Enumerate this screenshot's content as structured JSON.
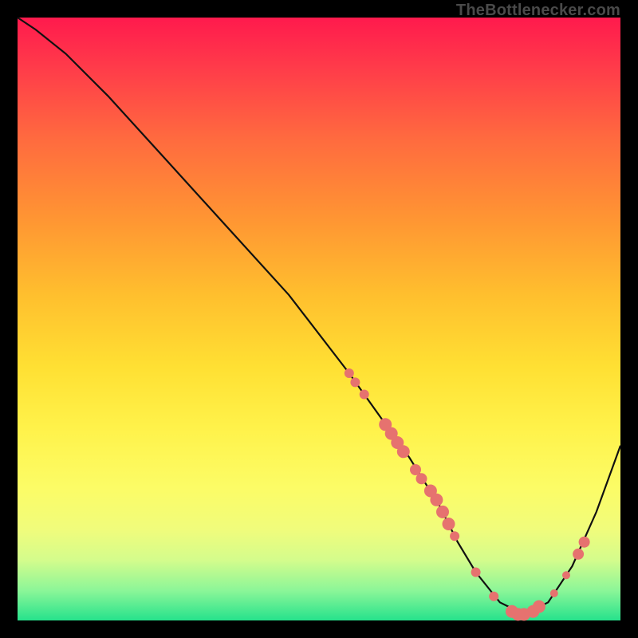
{
  "watermark": "TheBottlenecker.com",
  "chart_data": {
    "type": "line",
    "title": "",
    "xlabel": "",
    "ylabel": "",
    "xlim": [
      0,
      100
    ],
    "ylim": [
      0,
      100
    ],
    "grid": false,
    "legend": false,
    "x": [
      0,
      3,
      8,
      15,
      25,
      35,
      45,
      55,
      60,
      65,
      70,
      73,
      76,
      80,
      84,
      88,
      92,
      96,
      100
    ],
    "y": [
      100,
      98,
      94,
      87,
      76,
      65,
      54,
      41,
      34,
      27,
      19,
      13,
      8,
      3,
      1,
      3,
      9,
      18,
      29
    ],
    "series_note": "Single V-shaped bottleneck curve; minimum near x≈83",
    "markers": [
      {
        "x": 55.0,
        "y": 41.0,
        "r": 6
      },
      {
        "x": 56.0,
        "y": 39.5,
        "r": 6
      },
      {
        "x": 57.5,
        "y": 37.5,
        "r": 6
      },
      {
        "x": 61.0,
        "y": 32.5,
        "r": 8
      },
      {
        "x": 62.0,
        "y": 31.0,
        "r": 8
      },
      {
        "x": 63.0,
        "y": 29.5,
        "r": 8
      },
      {
        "x": 64.0,
        "y": 28.0,
        "r": 8
      },
      {
        "x": 66.0,
        "y": 25.0,
        "r": 7
      },
      {
        "x": 67.0,
        "y": 23.5,
        "r": 7
      },
      {
        "x": 68.5,
        "y": 21.5,
        "r": 8
      },
      {
        "x": 69.5,
        "y": 20.0,
        "r": 8
      },
      {
        "x": 70.5,
        "y": 18.0,
        "r": 8
      },
      {
        "x": 71.5,
        "y": 16.0,
        "r": 8
      },
      {
        "x": 72.5,
        "y": 14.0,
        "r": 6
      },
      {
        "x": 76.0,
        "y": 8.0,
        "r": 6
      },
      {
        "x": 79.0,
        "y": 4.0,
        "r": 6
      },
      {
        "x": 82.0,
        "y": 1.5,
        "r": 8
      },
      {
        "x": 83.0,
        "y": 1.0,
        "r": 8
      },
      {
        "x": 84.0,
        "y": 1.0,
        "r": 8
      },
      {
        "x": 85.5,
        "y": 1.5,
        "r": 8
      },
      {
        "x": 86.5,
        "y": 2.3,
        "r": 8
      },
      {
        "x": 89.0,
        "y": 4.5,
        "r": 5
      },
      {
        "x": 91.0,
        "y": 7.5,
        "r": 5
      },
      {
        "x": 93.0,
        "y": 11.0,
        "r": 7
      },
      {
        "x": 94.0,
        "y": 13.0,
        "r": 7
      }
    ]
  }
}
